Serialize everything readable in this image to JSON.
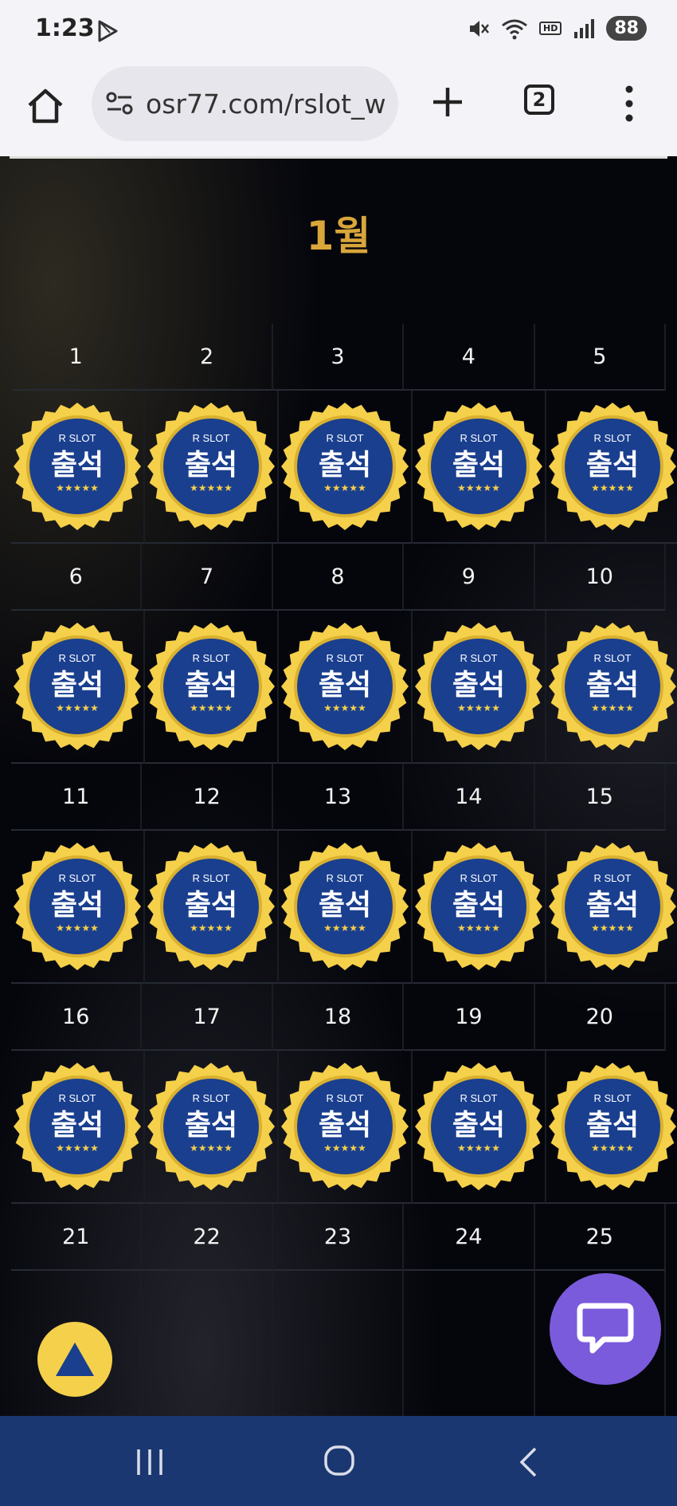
{
  "status_bar": {
    "time": "1:23",
    "battery": "88",
    "hd_label": "HD",
    "icons": [
      "play-store-icon",
      "mute-icon",
      "wifi-icon",
      "hd-voice-icon",
      "signal-icon",
      "battery-icon"
    ]
  },
  "browser": {
    "url": "osr77.com/rslot_w",
    "tab_count": "2"
  },
  "page": {
    "month_title": "1월",
    "badge": {
      "brand": "R SLOT",
      "label": "출석",
      "stars": "★★★★★",
      "colors": {
        "ring": "#f5d04a",
        "face": "#1a3f8f",
        "stars": "#f5d04a"
      }
    },
    "days": [
      "1",
      "2",
      "3",
      "4",
      "5",
      "6",
      "7",
      "8",
      "9",
      "10",
      "11",
      "12",
      "13",
      "14",
      "15",
      "16",
      "17",
      "18",
      "19",
      "20",
      "21",
      "22",
      "23",
      "24",
      "25"
    ],
    "attended_days": 20
  },
  "accent_colors": {
    "month": "#d9a63a",
    "chat": "#7a5bdc",
    "scroll_top": "#f5d04a",
    "nav": "#1b3772"
  }
}
